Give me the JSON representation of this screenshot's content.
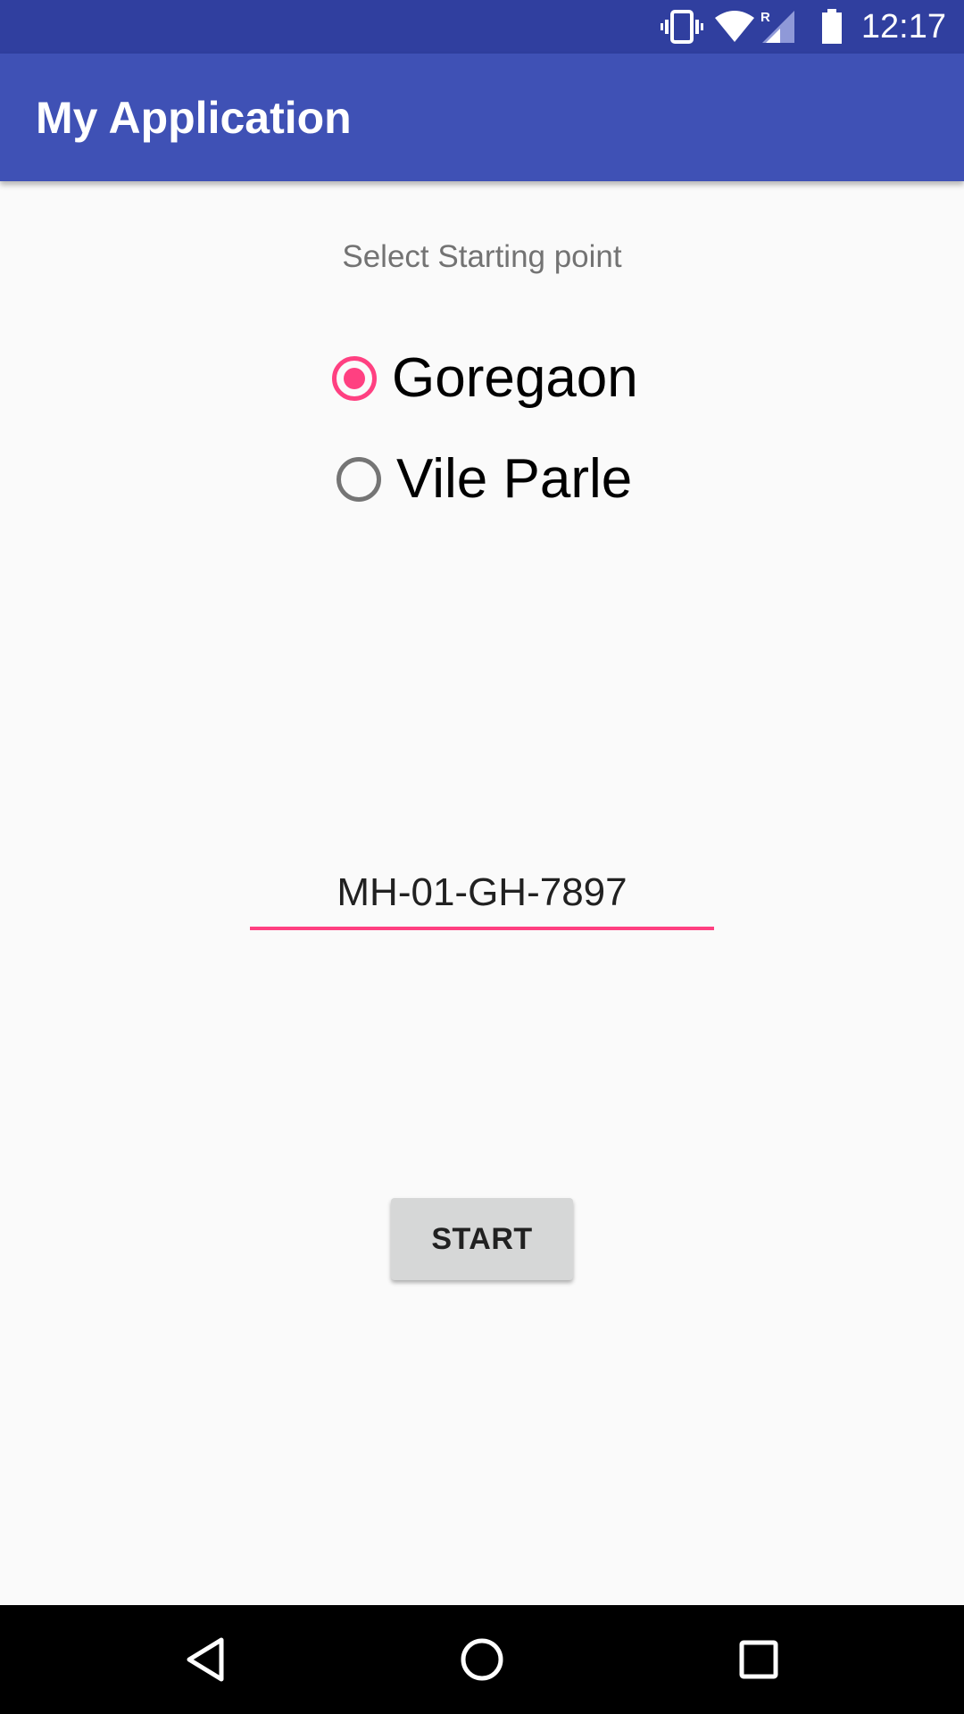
{
  "status_bar": {
    "time": "12:17",
    "roaming_indicator": "R",
    "icons": [
      "vibrate-icon",
      "wifi-icon",
      "cellular-signal-icon",
      "battery-icon"
    ]
  },
  "app_bar": {
    "title": "My Application"
  },
  "form": {
    "prompt": "Select Starting point",
    "options": [
      {
        "label": "Goregaon",
        "checked": true
      },
      {
        "label": "Vile Parle",
        "checked": false
      }
    ],
    "plate_value": "MH-01-GH-7897",
    "start_label": "START"
  },
  "nav_bar": {
    "icons": [
      "back-icon",
      "home-icon",
      "recents-icon"
    ]
  },
  "colors": {
    "status_bar": "#303f9f",
    "primary": "#3f51b5",
    "accent": "#ff4081",
    "background": "#fafafa",
    "button": "#d6d7d7"
  }
}
